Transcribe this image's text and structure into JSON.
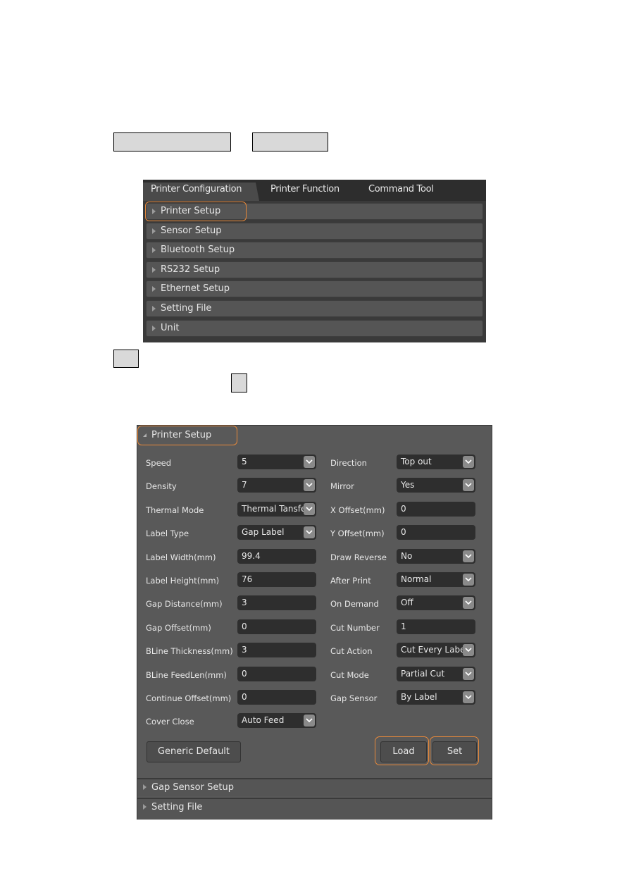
{
  "page": {
    "placeholders": [
      {
        "name": "menu-path-box-1"
      },
      {
        "name": "menu-path-box-2"
      },
      {
        "name": "step-box-1"
      },
      {
        "name": "step-box-2"
      }
    ]
  },
  "panel1": {
    "tabs": [
      {
        "label": "Printer Configuration",
        "active": true
      },
      {
        "label": "Printer Function",
        "active": false
      },
      {
        "label": "Command Tool",
        "active": false
      }
    ],
    "items": [
      {
        "label": "Printer Setup",
        "highlighted": true
      },
      {
        "label": "Sensor Setup"
      },
      {
        "label": "Bluetooth Setup"
      },
      {
        "label": "RS232 Setup"
      },
      {
        "label": "Ethernet Setup"
      },
      {
        "label": "Setting File"
      },
      {
        "label": "Unit"
      }
    ],
    "highlight_color": "#e8893a"
  },
  "panel2": {
    "header": "Printer Setup",
    "left_fields": [
      {
        "label": "Speed",
        "value": "5",
        "type": "select"
      },
      {
        "label": "Density",
        "value": "7",
        "type": "select"
      },
      {
        "label": "Thermal Mode",
        "value": "Thermal Tansfe",
        "type": "select"
      },
      {
        "label": "Label Type",
        "value": "Gap Label",
        "type": "select"
      },
      {
        "label": "Label Width(mm)",
        "value": "99.4",
        "type": "input"
      },
      {
        "label": "Label Height(mm)",
        "value": "76",
        "type": "input"
      },
      {
        "label": "Gap Distance(mm)",
        "value": "3",
        "type": "input"
      },
      {
        "label": "Gap Offset(mm)",
        "value": "0",
        "type": "input"
      },
      {
        "label": "BLine Thickness(mm)",
        "value": "3",
        "type": "input"
      },
      {
        "label": "BLine FeedLen(mm)",
        "value": "0",
        "type": "input"
      },
      {
        "label": "Continue Offset(mm)",
        "value": "0",
        "type": "input"
      },
      {
        "label": "Cover Close",
        "value": "Auto Feed",
        "type": "select"
      }
    ],
    "right_fields": [
      {
        "label": "Direction",
        "value": "Top out",
        "type": "select"
      },
      {
        "label": "Mirror",
        "value": "Yes",
        "type": "select"
      },
      {
        "label": "X Offset(mm)",
        "value": "0",
        "type": "input"
      },
      {
        "label": "Y Offset(mm)",
        "value": "0",
        "type": "input"
      },
      {
        "label": "Draw Reverse",
        "value": "No",
        "type": "select"
      },
      {
        "label": "After Print",
        "value": "Normal",
        "type": "select"
      },
      {
        "label": "On Demand",
        "value": "Off",
        "type": "select"
      },
      {
        "label": "Cut Number",
        "value": "1",
        "type": "input"
      },
      {
        "label": "Cut Action",
        "value": "Cut Every Labe",
        "type": "select"
      },
      {
        "label": "Cut Mode",
        "value": "Partial Cut",
        "type": "select"
      },
      {
        "label": "Gap Sensor",
        "value": "By Label",
        "type": "select"
      }
    ],
    "buttons": {
      "generic_default": "Generic Default",
      "load": "Load",
      "set": "Set"
    },
    "sub_sections": [
      {
        "label": "Gap Sensor Setup"
      },
      {
        "label": "Setting File"
      }
    ]
  }
}
